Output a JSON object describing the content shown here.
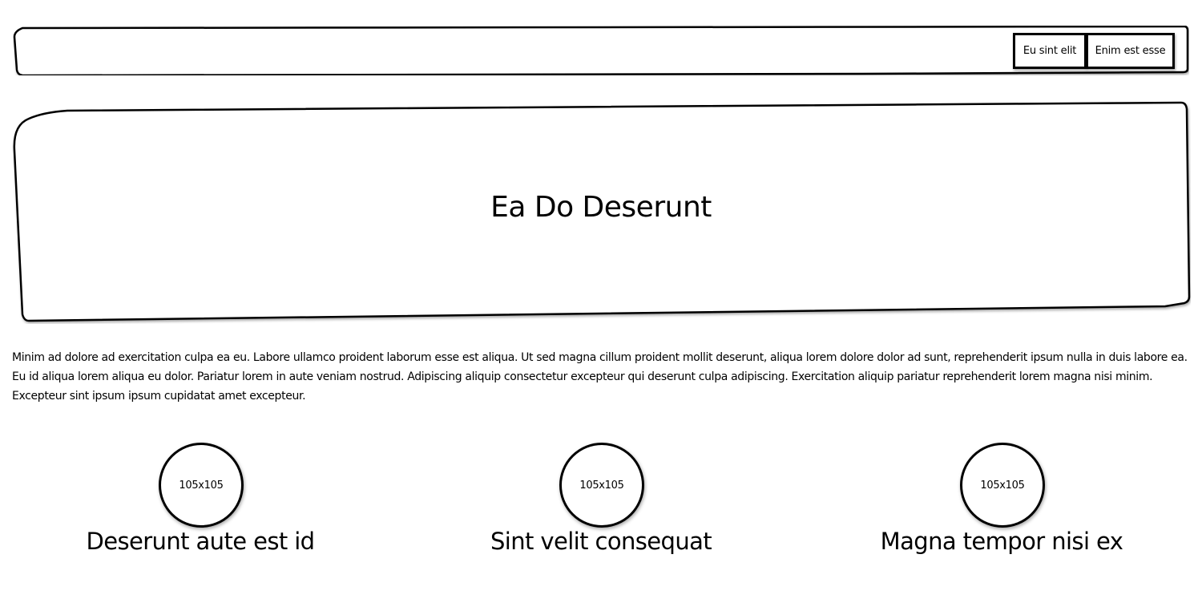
{
  "nav": {
    "items": [
      {
        "label": "Eu sint elit"
      },
      {
        "label": "Enim est esse"
      }
    ]
  },
  "hero": {
    "title": "Ea Do Deserunt"
  },
  "intro": {
    "text": "Minim ad dolore ad exercitation culpa ea eu. Labore ullamco proident laborum esse est aliqua. Ut sed magna cillum proident mollit deserunt, aliqua lorem dolore dolor ad sunt, reprehenderit ipsum nulla in duis labore ea. Eu id aliqua lorem aliqua eu dolor. Pariatur lorem in aute veniam nostrud. Adipiscing aliquip consectetur excepteur qui deserunt culpa adipiscing. Exercitation aliquip pariatur reprehenderit lorem magna nisi minim. Excepteur sint ipsum ipsum cupidatat amet excepteur."
  },
  "features": [
    {
      "image_placeholder": "105x105",
      "title": "Deserunt aute est id"
    },
    {
      "image_placeholder": "105x105",
      "title": "Sint velit consequat"
    },
    {
      "image_placeholder": "105x105",
      "title": "Magna tempor nisi ex"
    }
  ]
}
